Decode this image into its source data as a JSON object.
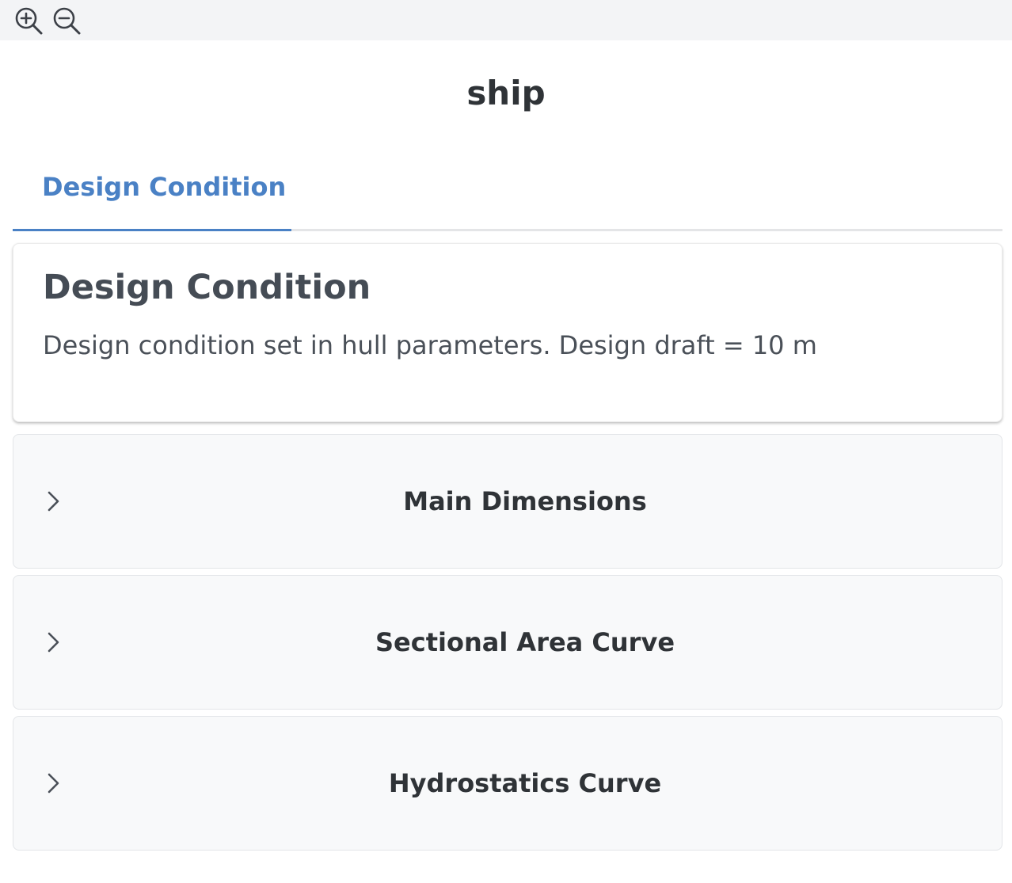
{
  "toolbar": {
    "zoom_in_icon": "zoom-in-icon",
    "zoom_out_icon": "zoom-out-icon"
  },
  "page": {
    "title": "ship"
  },
  "tabs": [
    {
      "label": "Design Condition",
      "active": true
    }
  ],
  "card": {
    "title": "Design Condition",
    "text": "Design condition set in hull parameters. Design draft = 10 m"
  },
  "sections": [
    {
      "label": "Main Dimensions",
      "expanded": false,
      "icon": "chevron-right-icon"
    },
    {
      "label": "Sectional Area Curve",
      "expanded": false,
      "icon": "chevron-right-icon"
    },
    {
      "label": "Hydrostatics Curve",
      "expanded": false,
      "icon": "chevron-right-icon"
    }
  ],
  "colors": {
    "accent": "#4a81c5",
    "toolbar_bg": "#f3f4f6",
    "accordion_bg": "#f8f9fa",
    "text_dark": "#2f3337"
  }
}
